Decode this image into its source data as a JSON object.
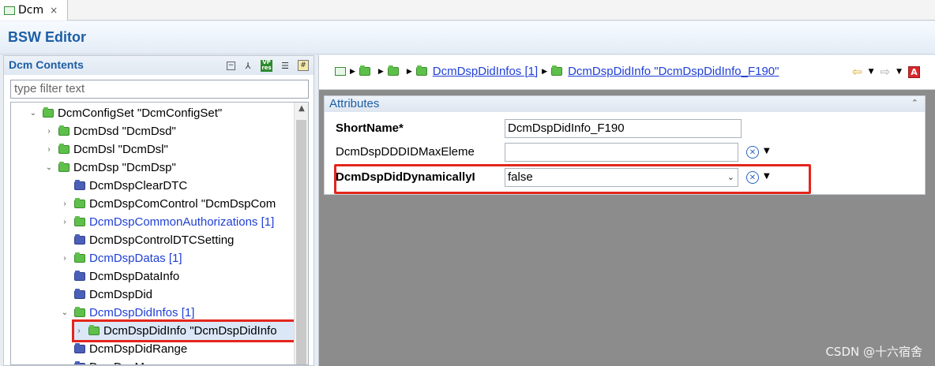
{
  "tab": {
    "label": "Dcm",
    "close": "×"
  },
  "editor": {
    "title": "BSW Editor"
  },
  "left": {
    "title": "Dcm Contents",
    "filter_placeholder": "type filter text",
    "tools": {
      "collapse": "−",
      "link": "⅄",
      "vp_top": "VP",
      "vp_bottom": "res",
      "doc": "☰",
      "grid": "#"
    },
    "tree": [
      {
        "label": "DcmConfigSet \"DcmConfigSet\"",
        "expander": "v",
        "icon": "green",
        "link": false
      },
      {
        "label": "DcmDsd \"DcmDsd\"",
        "expander": ">",
        "icon": "green",
        "link": false
      },
      {
        "label": "DcmDsl \"DcmDsl\"",
        "expander": ">",
        "icon": "green",
        "link": false
      },
      {
        "label": "DcmDsp \"DcmDsp\"",
        "expander": "v",
        "icon": "green",
        "link": false
      },
      {
        "label": "DcmDspClearDTC",
        "expander": "",
        "icon": "blue",
        "link": false
      },
      {
        "label": "DcmDspComControl \"DcmDspCom",
        "expander": ">",
        "icon": "green",
        "link": false
      },
      {
        "label": "DcmDspCommonAuthorizations [1]",
        "expander": ">",
        "icon": "green",
        "link": true
      },
      {
        "label": "DcmDspControlDTCSetting",
        "expander": "",
        "icon": "blue",
        "link": false
      },
      {
        "label": "DcmDspDatas [1]",
        "expander": ">",
        "icon": "green",
        "link": true
      },
      {
        "label": "DcmDspDataInfo",
        "expander": "",
        "icon": "blue",
        "link": false
      },
      {
        "label": "DcmDspDid",
        "expander": "",
        "icon": "blue",
        "link": false
      },
      {
        "label": "DcmDspDidInfos [1]",
        "expander": "v",
        "icon": "green",
        "link": true
      },
      {
        "label": "DcmDspDidInfo \"DcmDspDidInfo",
        "expander": ">",
        "icon": "green",
        "link": false
      },
      {
        "label": "DcmDspDidRange",
        "expander": "",
        "icon": "blue",
        "link": false
      },
      {
        "label": "DcmDspMemory",
        "expander": ">",
        "icon": "blue",
        "link": false
      }
    ],
    "scroll_up": "▲"
  },
  "right": {
    "breadcrumb": {
      "arrow": "▶",
      "item1": "DcmDspDidInfos [1]",
      "item2": "DcmDspDidInfo \"DcmDspDidInfo_F190\""
    },
    "nav": {
      "back": "⇦",
      "forward": "⇨",
      "dropdown": "▼",
      "a": "A"
    },
    "attributes": {
      "title": "Attributes",
      "collapse": "⌃",
      "rows": [
        {
          "label": "ShortName*",
          "value": "DcmDspDidInfo_F190"
        },
        {
          "label": "DcmDspDDDIDMaxEleme",
          "value": ""
        },
        {
          "label": "DcmDspDidDynamicallyI",
          "value": "false"
        }
      ],
      "clear": "✕",
      "select_arrow": "⌄",
      "dd": "▼"
    }
  },
  "watermark": "CSDN @十六宿舍"
}
